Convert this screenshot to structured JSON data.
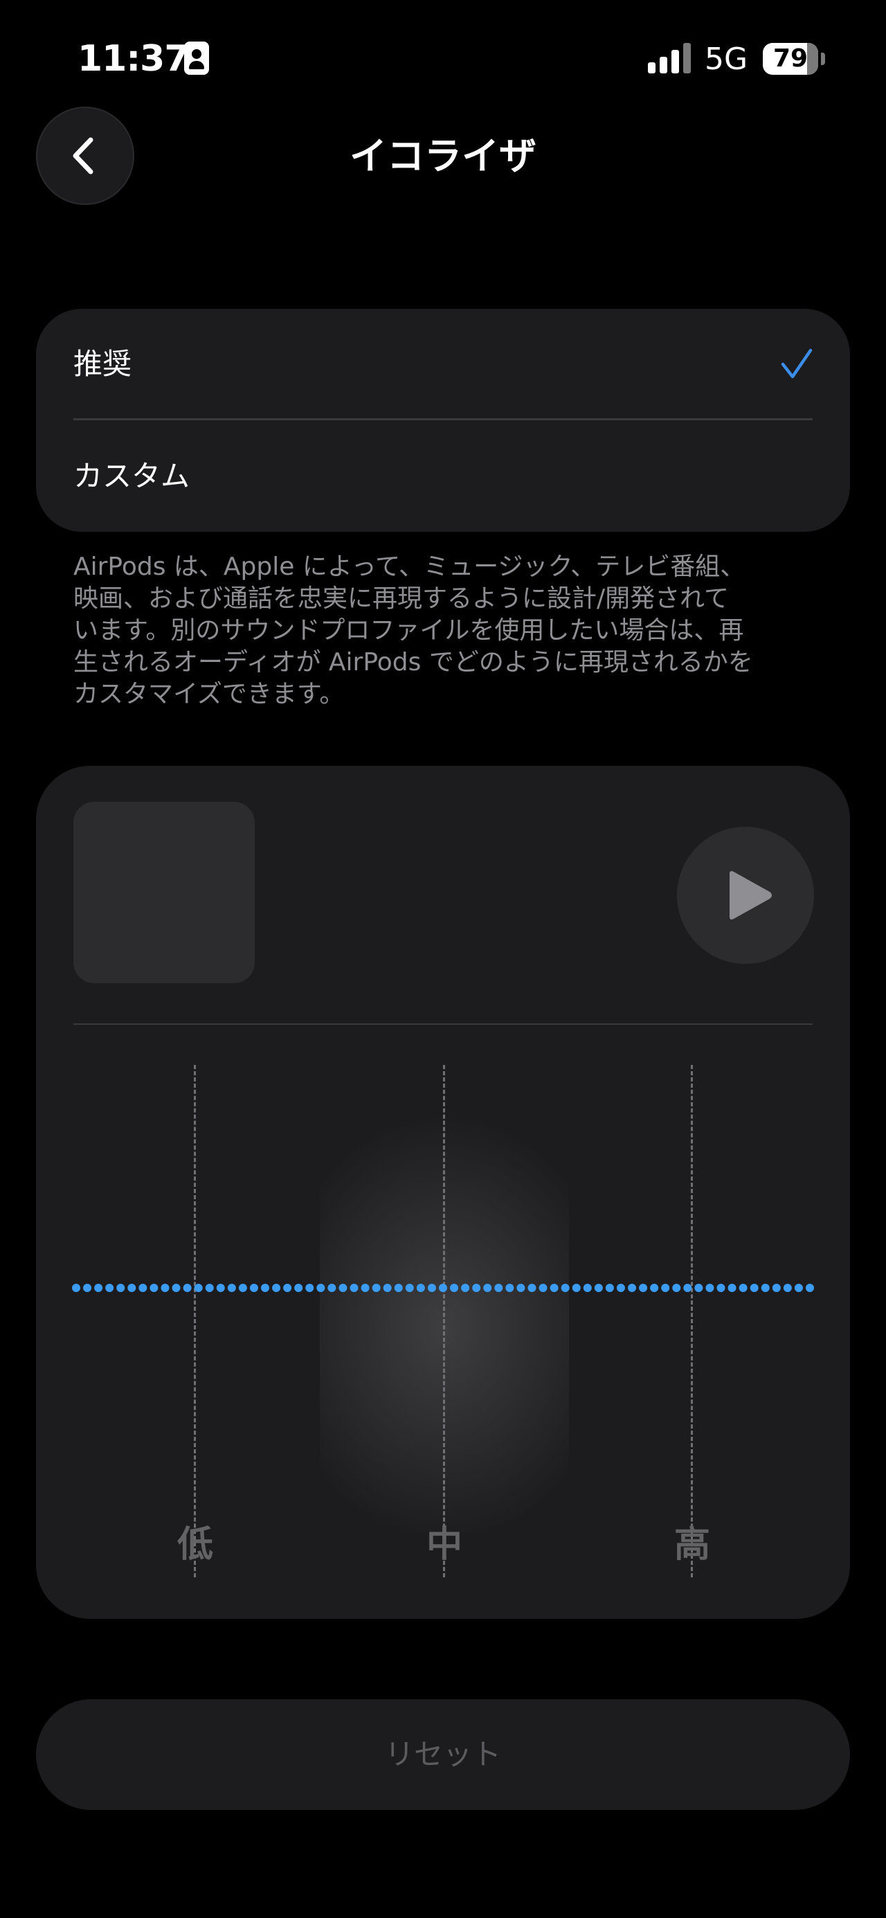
{
  "status_bar": {
    "time": "11:37",
    "network": "5G",
    "battery_percent": "79",
    "battery_level": 0.79,
    "signal_bars": 4
  },
  "nav": {
    "title": "イコライザ",
    "back_icon": "chevron-left-icon"
  },
  "options": {
    "items": [
      {
        "label": "推奨",
        "selected": true
      },
      {
        "label": "カスタム",
        "selected": false
      }
    ],
    "check_icon": "checkmark-icon"
  },
  "description": "AirPods は、Apple によって、ミュージック、テレビ番組、\n映画、および通話を忠実に再現するように設計/開発されて\nいます。別のサウンドプロファイルを使用したい場合は、再\n生されるオーディオが AirPods でどのように再現されるかを\nカスタマイズできます。",
  "eq": {
    "play_icon": "play-icon",
    "bands": [
      {
        "label": "低"
      },
      {
        "label": "中"
      },
      {
        "label": "高"
      }
    ],
    "curve_level": 0,
    "colors": {
      "curve": "#3b9cf2",
      "band_line": "#707074",
      "label": "#636366"
    }
  },
  "reset": {
    "label": "リセット"
  },
  "colors": {
    "accent": "#3b8de8",
    "background": "#000000",
    "card": "#1c1c1e"
  }
}
